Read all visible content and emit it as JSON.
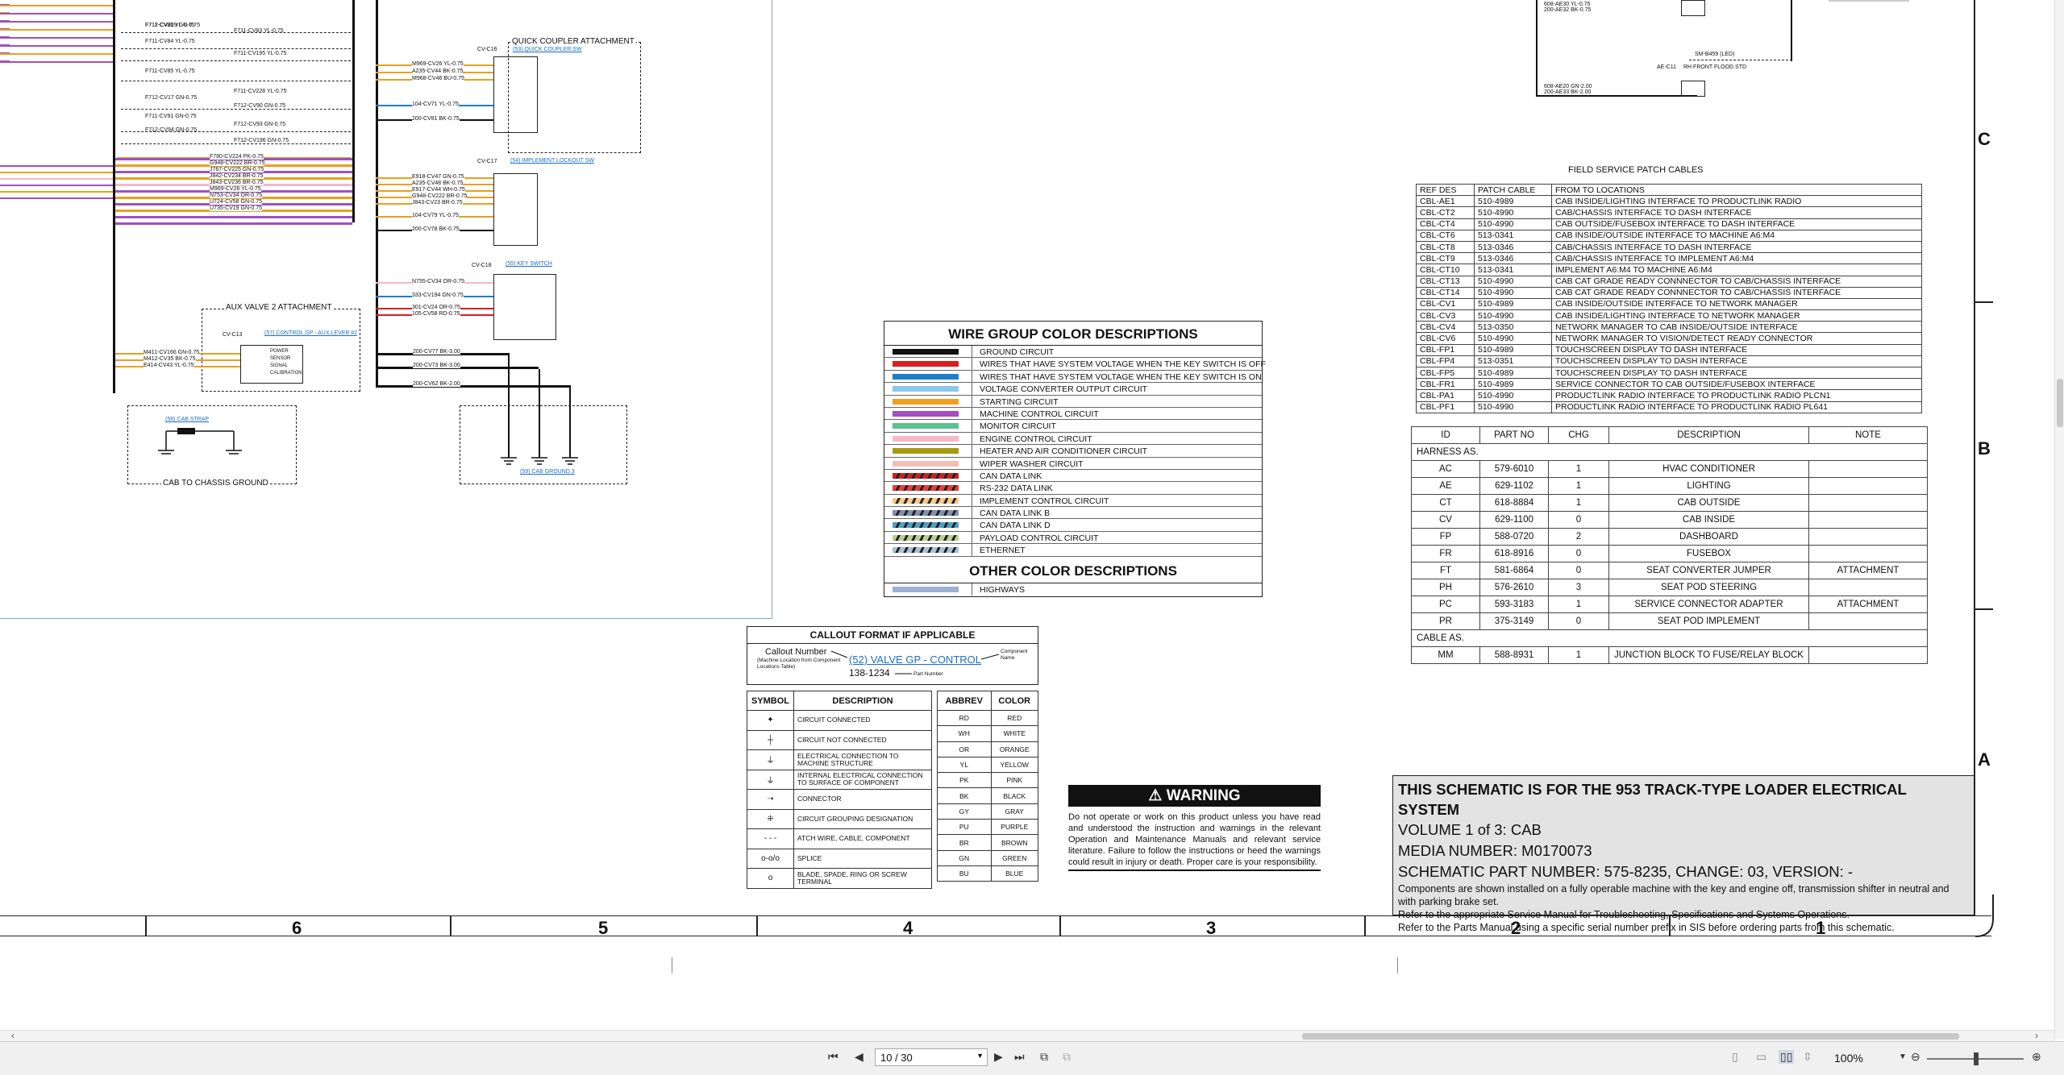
{
  "schematic": {
    "left_wires": [
      {
        "label": "F711-CV86 YL-0.75",
        "color": "#e8a020"
      },
      {
        "label": "F711-CV83 YL-0.75",
        "color": "#e8a020"
      },
      {
        "label": "F711-CV84 YL-0.75",
        "color": "#e8a020"
      },
      {
        "label": "F711-CV195 YL-0.75",
        "color": "#e8a020"
      },
      {
        "label": "F711-CV85 YL-0.75",
        "color": "#e8a020"
      },
      {
        "label": "F711-CV228 YL-0.75",
        "color": "#e8a020"
      },
      {
        "label": "F712-CV17 GN-0.75",
        "color": "#6a3fa0"
      },
      {
        "label": "F712-CV90 GN-0.75",
        "color": "#6a3fa0"
      },
      {
        "label": "F711-CV91 GN-0.75",
        "color": "#6a3fa0"
      },
      {
        "label": "F712-CV93 GN-0.75",
        "color": "#6a3fa0"
      },
      {
        "label": "F712-CV94 GN-0.75",
        "color": "#6a3fa0"
      },
      {
        "label": "F712-CV196 GN-0.75",
        "color": "#6a3fa0"
      },
      {
        "label": "F712-CV229 GN-0.75",
        "color": "#6a3fa0"
      }
    ],
    "bundle_labels": [
      "F780-CV224 PK-0.75",
      "G948-CV222 BR-0.75",
      "J767-CV225 GN-0.75",
      "J842-CV234 BR-0.75",
      "J843-CV236 BR-0.75",
      "M969-CV26 YL-0.75",
      "N753-CV34 OR-0.75",
      "U724-CV58 GN-0.75",
      "U735-CV19 GN-0.75"
    ],
    "quick_coupler": {
      "title": "QUICK COUPLER ATTACHMENT",
      "link": "(53) QUICK COUPLER SW",
      "part": "CV-C16",
      "wires": [
        "M969-CV26 YL-0.75",
        "A235-CV44 BK-0.75",
        "M968-CV46 BU-0.75",
        "104-CV71 YL-0.75",
        "200-CV81 BK-0.75"
      ]
    },
    "implement_lockout": {
      "part": "CV-C17",
      "link": "(54) IMPLEMENT LOCKOUT SW",
      "wires": [
        "E918-CV47 GN-0.75",
        "A235-CV48 BK-0.75",
        "E917-CV44 WH-0.75",
        "G948-CV222 BR-0.75",
        "J843-CV23 BR-0.75",
        "104-CV79 YL-0.75",
        "200-CV78 BK-0.75"
      ]
    },
    "key_switch": {
      "part": "CV-C18",
      "link": "(55) KEY SWITCH",
      "wires": [
        "N755-CV34 OR-0.75",
        "333-CV194 GN-0.75",
        "301-CV24 OR-0.75",
        "105-CV58 RD-0.75"
      ]
    },
    "aux_valve": {
      "title": "AUX VALVE 2 ATTACHMENT",
      "link": "(57) CONTROL GP - AUX LEVER #2",
      "part": "CV-C13",
      "wires": [
        "M411-CV166 GN-0.75",
        "M412-CV35 BK-0.75",
        "E414-CV43 YL-0.75"
      ],
      "pins": [
        "POWER",
        "SENSOR",
        "SIGNAL",
        "CALIBRATION"
      ]
    },
    "grounds": [
      "200-CV77 BK-3.00",
      "200-CV73 BK-3.00",
      "200-CV62 BK-2.00"
    ],
    "cab_strap": {
      "link": "(58) CAB STRAP",
      "title": "CAB TO CHASSIS GROUND"
    },
    "cab_ground_link": "(59) CAB GROUND 3",
    "top_right": {
      "labels": [
        "608-AE30 YL-0.75",
        "200-AE32 BK-0.75",
        "608-AE20 GN-2.00",
        "200-AE33 BK-2.00"
      ],
      "parts": [
        "AE-C11",
        "RH FRONT FLOOD STD",
        "SM-B459 (LED)"
      ]
    }
  },
  "wire_group": {
    "title": "WIRE GROUP COLOR DESCRIPTIONS",
    "rows": [
      {
        "label": "GROUND CIRCUIT",
        "color": "#111111",
        "stripe": false
      },
      {
        "label": "WIRES THAT HAVE SYSTEM VOLTAGE WHEN THE KEY SWITCH IS OFF",
        "color": "#d62020",
        "stripe": false
      },
      {
        "label": "WIRES THAT HAVE SYSTEM VOLTAGE WHEN THE KEY SWITCH IS ON",
        "color": "#1e7fc8",
        "stripe": false
      },
      {
        "label": "VOLTAGE CONVERTER OUTPUT CIRCUIT",
        "color": "#8cc8e8",
        "stripe": false
      },
      {
        "label": "STARTING CIRCUIT",
        "color": "#f0a020",
        "stripe": false
      },
      {
        "label": "MACHINE CONTROL CIRCUIT",
        "color": "#a050c0",
        "stripe": false
      },
      {
        "label": "MONITOR CIRCUIT",
        "color": "#5cc090",
        "stripe": false
      },
      {
        "label": "ENGINE CONTROL CIRCUIT",
        "color": "#f4b8c8",
        "stripe": false
      },
      {
        "label": "HEATER AND AIR CONDITIONER CIRCUIT",
        "color": "#a89a10",
        "stripe": false
      },
      {
        "label": "WIPER WASHER CIRCUIT",
        "color": "#f0c0b8",
        "stripe": false
      },
      {
        "label": "CAN DATA LINK",
        "color": "#d02020",
        "stripe": true
      },
      {
        "label": "RS-232 DATA LINK",
        "color": "#e83a3a",
        "stripe": true
      },
      {
        "label": "IMPLEMENT CONTROL CIRCUIT",
        "color": "#f8c888",
        "stripe": true
      },
      {
        "label": "CAN DATA LINK B",
        "color": "#8090b0",
        "stripe": true
      },
      {
        "label": "CAN DATA LINK D",
        "color": "#50a0c0",
        "stripe": true
      },
      {
        "label": "PAYLOAD CONTROL CIRCUIT",
        "color": "#b8d090",
        "stripe": true
      },
      {
        "label": "ETHERNET",
        "color": "#a8c0d8",
        "stripe": true
      }
    ],
    "other_title": "OTHER COLOR DESCRIPTIONS",
    "other_rows": [
      {
        "label": "HIGHWAYS",
        "color": "#9ab0d0"
      }
    ]
  },
  "callout": {
    "title": "CALLOUT FORMAT IF APPLICABLE",
    "callout_number": "Callout Number",
    "callout_note": "(Machine Location from Component Locations Table)",
    "example_link": "(52) VALVE GP - CONTROL",
    "component_name": "Component Name",
    "part_example": "138-1234",
    "part_number": "Part Number"
  },
  "symbols": {
    "headers": [
      "SYMBOL",
      "DESCRIPTION"
    ],
    "rows": [
      {
        "glyph": "✦",
        "desc": "CIRCUIT CONNECTED"
      },
      {
        "glyph": "┼",
        "desc": "CIRCUIT NOT CONNECTED"
      },
      {
        "glyph": "⏚",
        "desc": "ELECTRICAL CONNECTION TO MACHINE STRUCTURE"
      },
      {
        "glyph": "⏚",
        "desc": "INTERNAL ELECTRICAL CONNECTION TO SURFACE OF COMPONENT"
      },
      {
        "glyph": "➝",
        "desc": "CONNECTOR"
      },
      {
        "glyph": "⁜",
        "desc": "CIRCUIT GROUPING DESIGNATION"
      },
      {
        "glyph": "- - -",
        "desc": "ATCH WIRE, CABLE, COMPONENT"
      },
      {
        "glyph": "o-o/o",
        "desc": "SPLICE"
      },
      {
        "glyph": "o",
        "desc": "BLADE, SPADE, RING OR SCREW TERMINAL"
      }
    ]
  },
  "colors_table": {
    "headers": [
      "ABBREV",
      "COLOR"
    ],
    "rows": [
      [
        "RD",
        "RED"
      ],
      [
        "WH",
        "WHITE"
      ],
      [
        "OR",
        "ORANGE"
      ],
      [
        "YL",
        "YELLOW"
      ],
      [
        "PK",
        "PINK"
      ],
      [
        "BK",
        "BLACK"
      ],
      [
        "GY",
        "GRAY"
      ],
      [
        "PU",
        "PURPLE"
      ],
      [
        "BR",
        "BROWN"
      ],
      [
        "GN",
        "GREEN"
      ],
      [
        "BU",
        "BLUE"
      ]
    ]
  },
  "warning": {
    "title": "WARNING",
    "body": "Do not operate or work on this product unless you have read and understood the instruction and warnings in the relevant Operation and Maintenance Manuals and relevant service literature. Failure to follow the instructions or heed the warnings could result in injury or death. Proper care is your responsibility."
  },
  "field_service": {
    "title": "FIELD SERVICE PATCH CABLES",
    "headers": [
      "REF DES",
      "PATCH CABLE",
      "FROM TO LOCATIONS"
    ],
    "rows": [
      [
        "CBL-AE1",
        "510-4989",
        "CAB INSIDE/LIGHTING INTERFACE TO PRODUCTLINK RADIO"
      ],
      [
        "CBL-CT2",
        "510-4990",
        "CAB/CHASSIS INTERFACE TO DASH INTERFACE"
      ],
      [
        "CBL-CT4",
        "510-4990",
        "CAB OUTSIDE/FUSEBOX INTERFACE TO DASH INTERFACE"
      ],
      [
        "CBL-CT6",
        "513-0341",
        "CAB INSIDE/OUTSIDE INTERFACE TO MACHINE A6:M4"
      ],
      [
        "CBL-CT8",
        "513-0346",
        "CAB/CHASSIS INTERFACE TO DASH INTERFACE"
      ],
      [
        "CBL-CT9",
        "513-0346",
        "CAB/CHASSIS INTERFACE TO IMPLEMENT A6:M4"
      ],
      [
        "CBL-CT10",
        "513-0341",
        "IMPLEMENT A6:M4 TO MACHINE A6:M4"
      ],
      [
        "CBL-CT13",
        "510-4990",
        "CAB CAT GRADE READY CONNNECTOR TO CAB/CHASSIS INTERFACE"
      ],
      [
        "CBL-CT14",
        "510-4990",
        "CAB CAT GRADE READY CONNNECTOR TO CAB/CHASSIS INTERFACE"
      ],
      [
        "CBL-CV1",
        "510-4989",
        "CAB INSIDE/OUTSIDE INTERFACE TO NETWORK MANAGER"
      ],
      [
        "CBL-CV3",
        "510-4990",
        "CAB INSIDE/LIGHTING INTERFACE TO NETWORK MANAGER"
      ],
      [
        "CBL-CV4",
        "513-0350",
        "NETWORK MANAGER TO CAB INSIDE/OUTSIDE INTERFACE"
      ],
      [
        "CBL-CV6",
        "510-4990",
        "NETWORK MANAGER TO VISION/DETECT READY CONNECTOR"
      ],
      [
        "CBL-FP1",
        "510-4989",
        "TOUCHSCREEN DISPLAY TO DASH INTERFACE"
      ],
      [
        "CBL-FP4",
        "513-0351",
        "TOUCHSCREEN DISPLAY TO DASH INTERFACE"
      ],
      [
        "CBL-FP5",
        "510-4989",
        "TOUCHSCREEN DISPLAY TO DASH INTERFACE"
      ],
      [
        "CBL-FR1",
        "510-4989",
        "SERVICE CONNECTOR TO CAB OUTSIDE/FUSEBOX INTERFACE"
      ],
      [
        "CBL-PA1",
        "510-4990",
        "PRODUCTLINK RADIO INTERFACE TO PRODUCTLINK RADIO PLCN1"
      ],
      [
        "CBL-PF1",
        "510-4990",
        "PRODUCTLINK RADIO INTERFACE TO PRODUCTLINK RADIO PL641"
      ]
    ]
  },
  "harness": {
    "headers": [
      "ID",
      "PART NO",
      "CHG",
      "DESCRIPTION",
      "NOTE"
    ],
    "section1": "HARNESS AS.",
    "rows": [
      [
        "AC",
        "579-6010",
        "1",
        "HVAC CONDITIONER",
        ""
      ],
      [
        "AE",
        "629-1102",
        "1",
        "LIGHTING",
        ""
      ],
      [
        "CT",
        "618-8884",
        "1",
        "CAB OUTSIDE",
        ""
      ],
      [
        "CV",
        "629-1100",
        "0",
        "CAB INSIDE",
        ""
      ],
      [
        "FP",
        "588-0720",
        "2",
        "DASHBOARD",
        ""
      ],
      [
        "FR",
        "618-8916",
        "0",
        "FUSEBOX",
        ""
      ],
      [
        "FT",
        "581-6864",
        "0",
        "SEAT CONVERTER JUMPER",
        "ATTACHMENT"
      ],
      [
        "PH",
        "576-2610",
        "3",
        "SEAT POD STEERING",
        ""
      ],
      [
        "PC",
        "593-3183",
        "1",
        "SERVICE CONNECTOR ADAPTER",
        "ATTACHMENT"
      ],
      [
        "PR",
        "375-3149",
        "0",
        "SEAT POD IMPLEMENT",
        ""
      ]
    ],
    "section2": "CABLE AS.",
    "rows2": [
      [
        "MM",
        "588-8931",
        "1",
        "JUNCTION BLOCK TO FUSE/RELAY BLOCK",
        ""
      ]
    ]
  },
  "title_block": {
    "line1": "THIS SCHEMATIC IS FOR THE 953 TRACK-TYPE LOADER ELECTRICAL SYSTEM",
    "line2": "VOLUME 1 of 3: CAB",
    "line3": "MEDIA NUMBER: M0170073",
    "line4": "SCHEMATIC PART NUMBER: 575-8235, CHANGE: 03, VERSION: -",
    "notes": [
      "Components are shown installed on a fully operable machine with the key and engine off, transmission shifter in neutral and with parking brake set.",
      "Refer to the appropriate Service Manual for Troubleshooting, Specifications and Systems Operations.",
      "Refer to the Parts Manual using a specific serial number prefix in SIS before ordering parts from this schematic."
    ]
  },
  "zones": {
    "columns": [
      "6",
      "5",
      "4",
      "3",
      "2",
      "1"
    ],
    "rows": [
      "C",
      "B",
      "A"
    ]
  },
  "toolbar": {
    "page_value": "10 / 30",
    "zoom": "100%"
  }
}
